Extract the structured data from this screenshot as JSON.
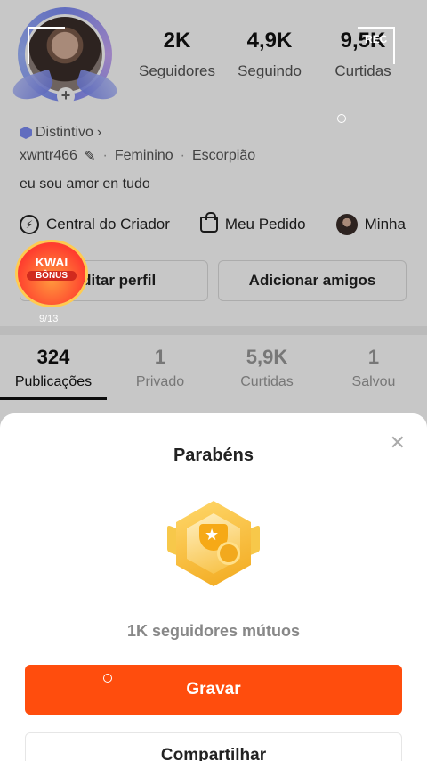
{
  "profile": {
    "stats": [
      {
        "value": "2K",
        "label": "Seguidores"
      },
      {
        "value": "4,9K",
        "label": "Seguindo"
      },
      {
        "value": "9,5K",
        "label": "Curtidas"
      }
    ],
    "badge_label": "Distintivo",
    "username": "xwntr466",
    "gender": "Feminino",
    "zodiac": "Escorpião",
    "bio": "eu sou amor en tudo",
    "quick_links": [
      "Central do Criador",
      "Meu Pedido",
      "Minha"
    ],
    "edit_profile_label": "Editar perfil",
    "add_friends_label": "Adicionar amigos"
  },
  "recorder": {
    "label": "REC"
  },
  "kwai_bonus": {
    "title": "KWAI",
    "subtitle": "BÔNUS",
    "counter": "9/13"
  },
  "tabs": [
    {
      "count": "324",
      "label": "Publicações",
      "active": true
    },
    {
      "count": "1",
      "label": "Privado",
      "active": false
    },
    {
      "count": "5,9K",
      "label": "Curtidas",
      "active": false
    },
    {
      "count": "1",
      "label": "Salvou",
      "active": false
    }
  ],
  "sheet": {
    "title": "Parabéns",
    "close_icon": "close-icon",
    "achievement": "1K seguidores mútuos",
    "primary_button": "Gravar",
    "secondary_button": "Compartilhar"
  },
  "colors": {
    "accent": "#ff4d0d",
    "ring": "#7d8cf5"
  }
}
